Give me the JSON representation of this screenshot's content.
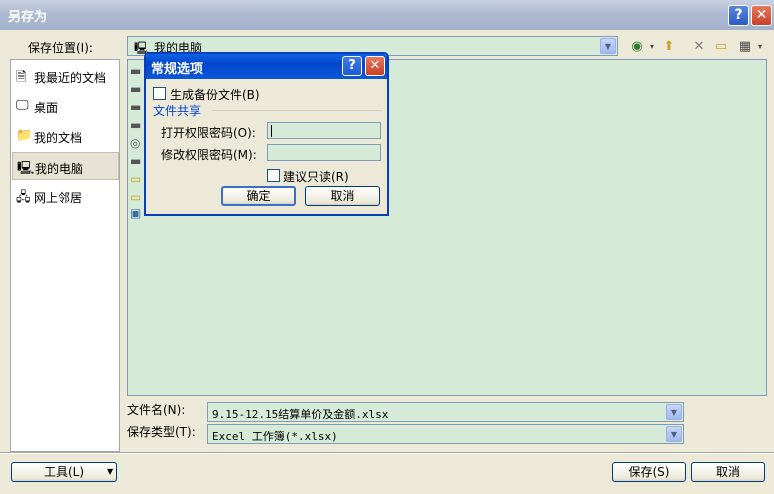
{
  "window": {
    "title": "另存为",
    "help": "?",
    "close": "✕"
  },
  "save_location": {
    "label": "保存位置(I):",
    "value": "我的电脑",
    "icon": "computer-icon"
  },
  "toolbar": {
    "icons": [
      "back-icon",
      "up-folder-icon",
      "delete-icon",
      "new-folder-icon",
      "views-icon"
    ]
  },
  "places": [
    {
      "label": "我最近的文档",
      "icon": "recent-documents-icon"
    },
    {
      "label": "桌面",
      "icon": "desktop-icon"
    },
    {
      "label": "我的文档",
      "icon": "my-documents-icon"
    },
    {
      "label": "我的电脑",
      "icon": "my-computer-icon",
      "selected": true
    },
    {
      "label": "网上邻居",
      "icon": "network-places-icon"
    }
  ],
  "file_name": {
    "label": "文件名(N):",
    "value": "9.15-12.15结算单价及金额.xlsx"
  },
  "file_type": {
    "label": "保存类型(T):",
    "value": "Excel 工作簿(*.xlsx)"
  },
  "buttons": {
    "tools": "工具(L)",
    "save": "保存(S)",
    "cancel": "取消"
  },
  "dialog": {
    "title": "常规选项",
    "help": "?",
    "close": "✕",
    "backup_label": "生成备份文件(B)",
    "group_label": "文件共享",
    "open_password_label": "打开权限密码(O):",
    "modify_password_label": "修改权限密码(M):",
    "readonly_label": "建议只读(R)",
    "ok": "确定",
    "cancel": "取消"
  }
}
